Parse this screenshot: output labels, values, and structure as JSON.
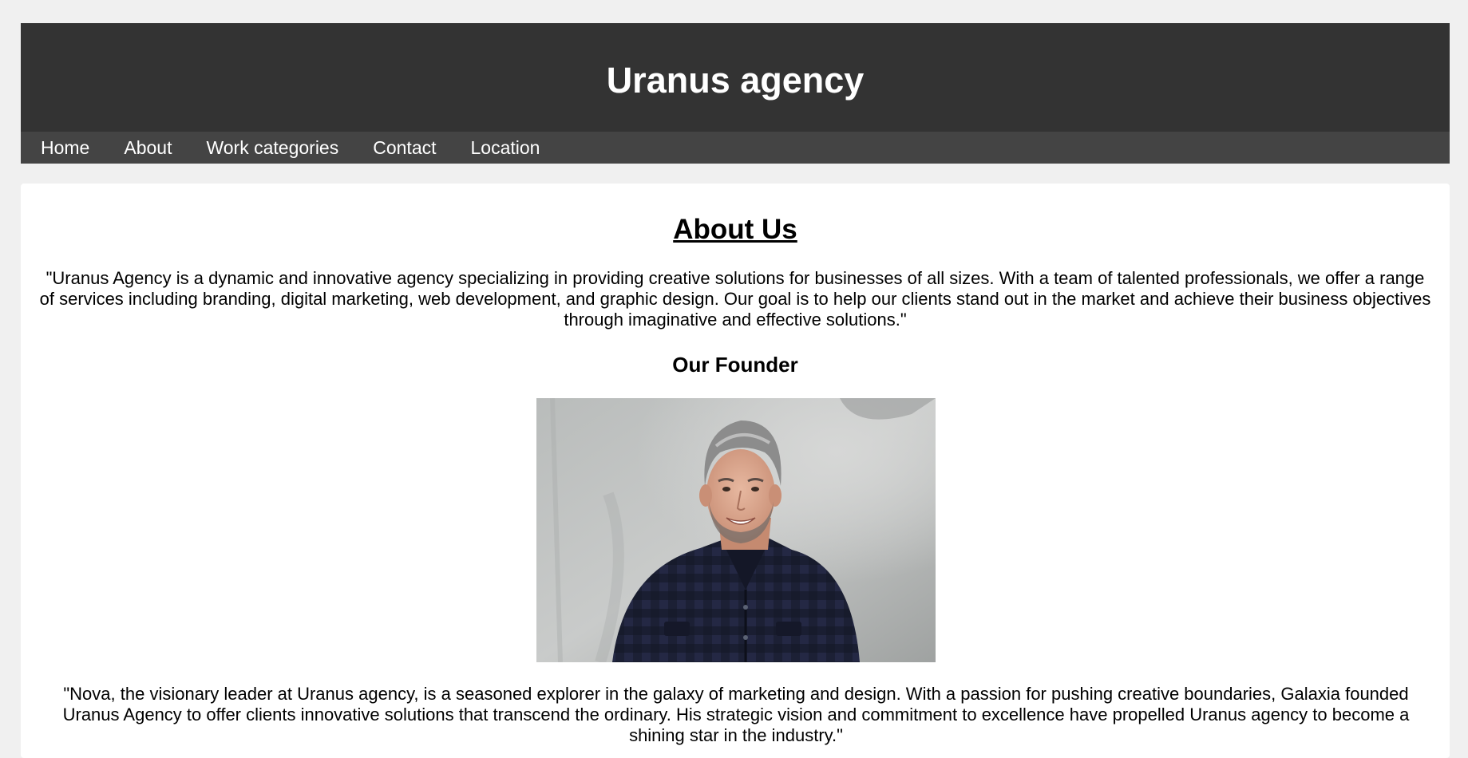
{
  "header": {
    "title": "Uranus agency"
  },
  "nav": {
    "items": [
      {
        "label": "Home"
      },
      {
        "label": "About"
      },
      {
        "label": "Work categories"
      },
      {
        "label": "Contact"
      },
      {
        "label": "Location"
      }
    ]
  },
  "about": {
    "heading": "About Us",
    "text": "\"Uranus Agency is a dynamic and innovative agency specializing in providing creative solutions for businesses of all sizes. With a team of talented professionals, we offer a range of services including branding, digital marketing, web development, and graphic design. Our goal is to help our clients stand out in the market and achieve their business objectives through imaginative and effective solutions.\""
  },
  "founder": {
    "heading": "Our Founder",
    "photo_icon": "founder-portrait",
    "bio": "\"Nova, the visionary leader at Uranus agency, is a seasoned explorer in the galaxy of marketing and design. With a passion for pushing creative boundaries, Galaxia founded Uranus Agency to offer clients innovative solutions that transcend the ordinary. His strategic vision and commitment to excellence have propelled Uranus agency to become a shining star in the industry.\""
  },
  "colors": {
    "header_bg": "#333333",
    "nav_bg": "#444444",
    "page_bg": "#f0f0f0",
    "card_bg": "#ffffff"
  }
}
